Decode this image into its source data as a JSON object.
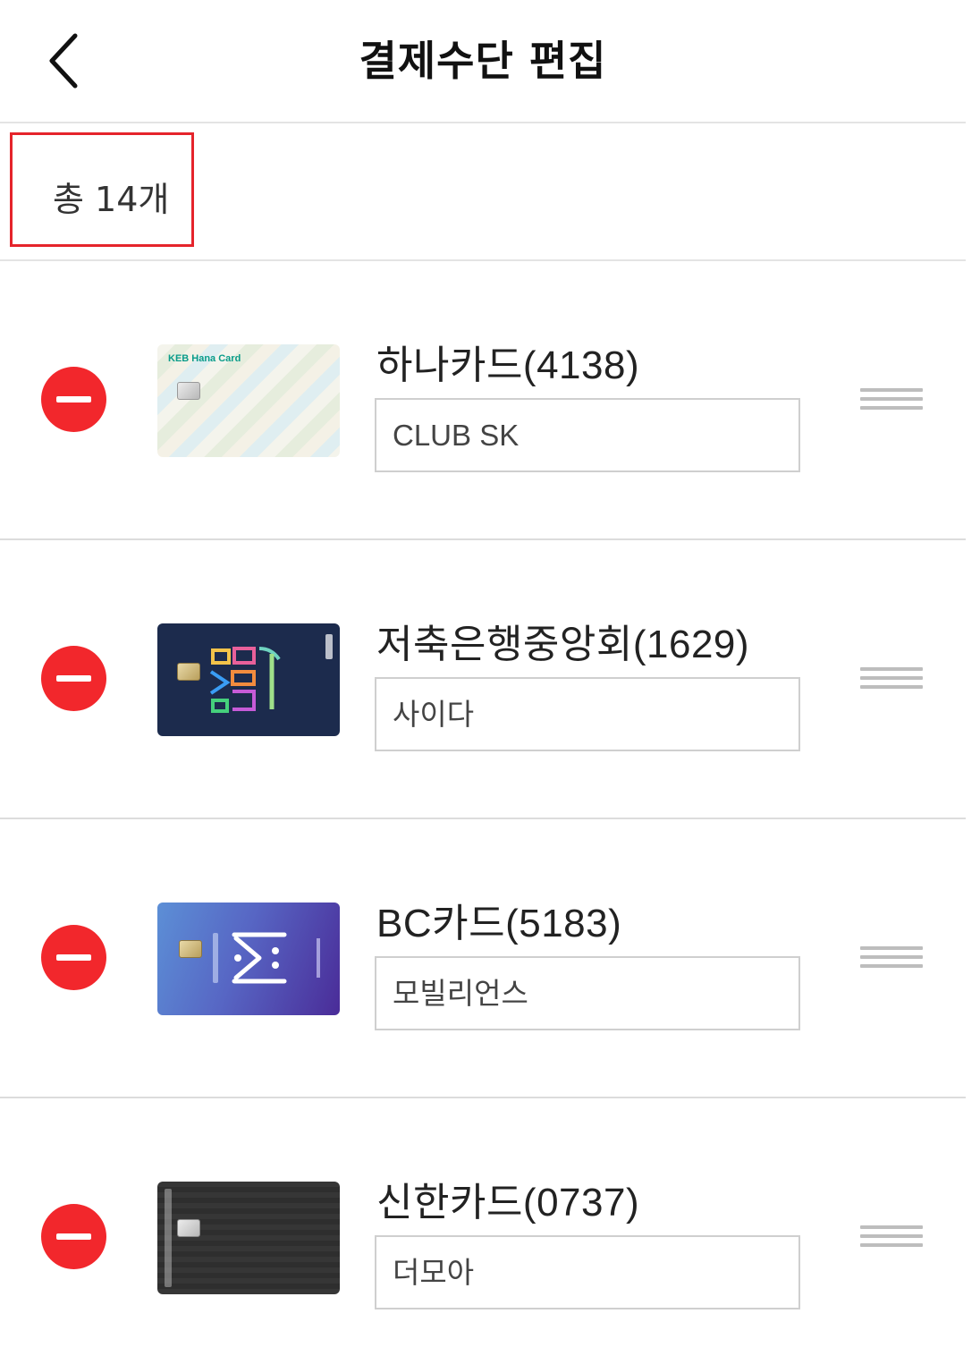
{
  "header": {
    "title": "결제수단 편집",
    "back_icon": "chevron-left-icon"
  },
  "summary": {
    "count_label": "총 14개"
  },
  "colors": {
    "accent_red": "#f2272c",
    "highlight_border": "#e5242b",
    "divider": "#e4e4e4"
  },
  "cards": [
    {
      "name": "하나카드(4138)",
      "nickname": "CLUB SK",
      "brand_text": "KEB Hana Card"
    },
    {
      "name": "저축은행중앙회(1629)",
      "nickname": "사이다"
    },
    {
      "name": "BC카드(5183)",
      "nickname": "모빌리언스"
    },
    {
      "name": "신한카드(0737)",
      "nickname": "더모아"
    }
  ]
}
